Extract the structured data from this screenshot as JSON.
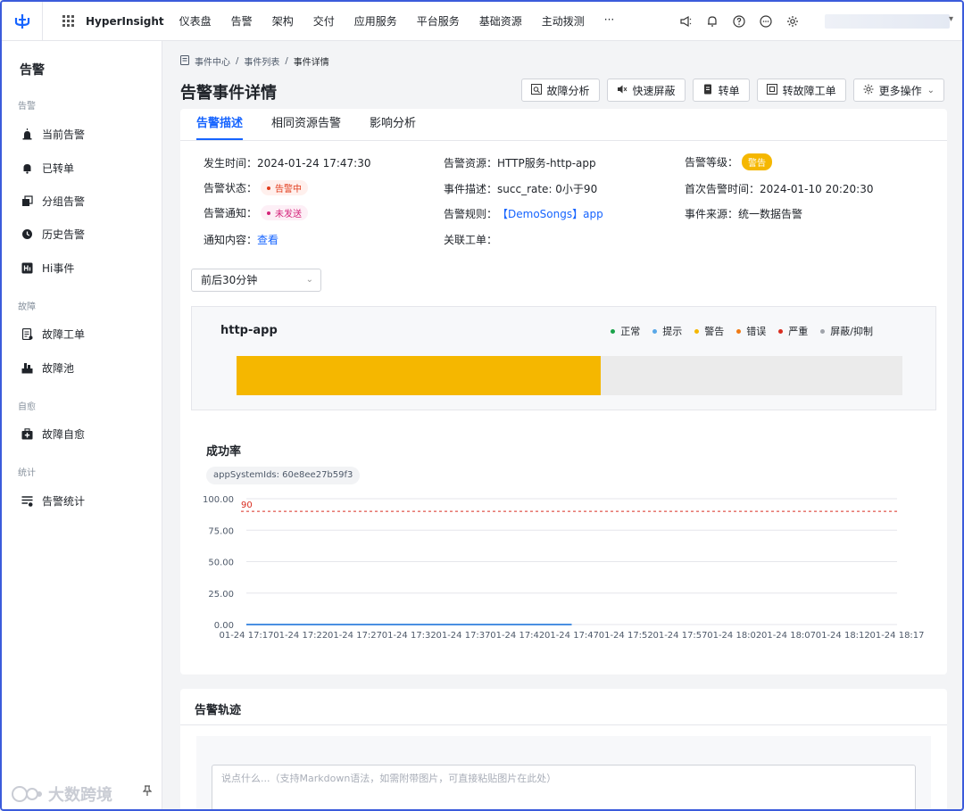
{
  "topnav": {
    "brand": "HyperInsight",
    "items": [
      "仪表盘",
      "告警",
      "架构",
      "交付",
      "应用服务",
      "平台服务",
      "基础资源",
      "主动拨测",
      "···"
    ]
  },
  "sidebar": {
    "title": "告警",
    "groups": {
      "alert": "告警",
      "fault": "故障",
      "self_heal": "自愈",
      "stats": "统计"
    },
    "items": {
      "current": "当前告警",
      "transferred": "已转单",
      "grouped": "分组告警",
      "history": "历史告警",
      "hi_event": "Hi事件",
      "fault_ticket": "故障工单",
      "fault_pool": "故障池",
      "fault_self_heal": "故障自愈",
      "alert_stats": "告警统计"
    },
    "watermark": "大数跨境"
  },
  "breadcrumb": {
    "level1": "事件中心",
    "level2": "事件列表",
    "current": "事件详情",
    "sep": "/"
  },
  "page": {
    "title": "告警事件详情"
  },
  "actions": {
    "fault_analysis": "故障分析",
    "quick_mute": "快速屏蔽",
    "transfer": "转单",
    "to_fault_ticket": "转故障工单",
    "more": "更多操作"
  },
  "tabs": [
    "告警描述",
    "相同资源告警",
    "影响分析"
  ],
  "details": {
    "occur_time_label": "发生时间：",
    "occur_time": "2024-01-24 17:47:30",
    "resource_label": "告警资源：",
    "resource": "HTTP服务-http-app",
    "level_label": "告警等级：",
    "level": "警告",
    "status_label": "告警状态：",
    "status": "告警中",
    "desc_label": "事件描述：",
    "desc": "succ_rate: 0小于90",
    "first_time_label": "首次告警时间：",
    "first_time": "2024-01-10 20:20:30",
    "notify_label": "告警通知：",
    "notify": "未发送",
    "rule_label": "告警规则：",
    "rule": "【DemoSongs】app",
    "source_label": "事件来源：",
    "source": "统一数据告警",
    "content_label": "通知内容：",
    "content": "查看",
    "ticket_label": "关联工单：",
    "ticket": ""
  },
  "time_range": "前后30分钟",
  "timeline": {
    "title": "http-app",
    "legend": [
      {
        "name": "正常",
        "color": "#1aa34a"
      },
      {
        "name": "提示",
        "color": "#59a8e8"
      },
      {
        "name": "警告",
        "color": "#f5b700"
      },
      {
        "name": "错误",
        "color": "#f07a14"
      },
      {
        "name": "严重",
        "color": "#d92d20"
      },
      {
        "name": "屏蔽/抑制",
        "color": "#a0a4ab"
      }
    ],
    "warning_fraction": 0.547
  },
  "chart_data": {
    "type": "line",
    "title": "成功率",
    "tag": "appSystemIds: 60e8ee27b59f3",
    "categories": [
      "01-24 17:17",
      "01-24 17:22",
      "01-24 17:27",
      "01-24 17:32",
      "01-24 17:37",
      "01-24 17:42",
      "01-24 17:47",
      "01-24 17:52",
      "01-24 17:57",
      "01-24 18:02",
      "01-24 18:07",
      "01-24 18:12",
      "01-24 18:17"
    ],
    "y_ticks": [
      "100.00",
      "75.00",
      "50.00",
      "25.00",
      "0.00"
    ],
    "ylim": [
      0,
      100
    ],
    "threshold": {
      "value": 90,
      "label": "90",
      "color": "#d92d20"
    },
    "series": [
      {
        "color": "#4a90e2",
        "points": [
          [
            0,
            0
          ],
          [
            6,
            0
          ]
        ]
      }
    ],
    "grid": true
  },
  "track": {
    "title": "告警轨迹",
    "comment_placeholder": "说点什么...（支持Markdown语法，如需附带图片，可直接粘贴图片在此处）"
  }
}
